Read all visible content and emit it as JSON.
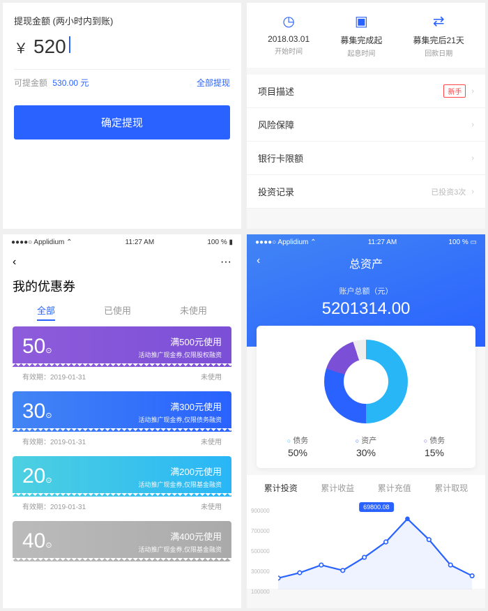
{
  "s1": {
    "label": "提现金额 (两小时内到账)",
    "amount": "520",
    "avail_label": "可提金额",
    "avail_val": "530.00 元",
    "all_link": "全部提现",
    "btn": "确定提现"
  },
  "s2": {
    "cols": [
      {
        "v1": "2018.03.01",
        "v2": "开始时间"
      },
      {
        "v1": "募集完成起",
        "v2": "起息时间"
      },
      {
        "v1": "募集完后21天",
        "v2": "回款日期"
      }
    ],
    "rows": [
      {
        "label": "项目描述",
        "badge": "新手"
      },
      {
        "label": "风险保障"
      },
      {
        "label": "银行卡限额"
      },
      {
        "label": "投资记录",
        "note": "已投资3次"
      }
    ]
  },
  "s3": {
    "status": {
      "carrier": "●●●●○ Applidium ⌃",
      "time": "11:27 AM",
      "batt": "100 % ▮"
    },
    "title": "我的优惠券",
    "tabs": [
      "全部",
      "已使用",
      "未使用"
    ],
    "coupons": [
      {
        "amt": "50",
        "cond": "满500元使用",
        "desc": "活动推广现金券,仅限股权融资",
        "exp": "有效期：2019-01-31",
        "status": "未使用",
        "cls": "c-purple"
      },
      {
        "amt": "30",
        "cond": "满300元使用",
        "desc": "活动推广现金券,仅限债务融资",
        "exp": "有效期：2019-01-31",
        "status": "未使用",
        "cls": "c-blue1"
      },
      {
        "amt": "20",
        "cond": "满200元使用",
        "desc": "活动推广现金券,仅限基金融资",
        "exp": "有效期：2019-01-31",
        "status": "未使用",
        "cls": "c-blue2"
      },
      {
        "amt": "40",
        "cond": "满400元使用",
        "desc": "活动推广现金券,仅限基金融资",
        "exp": "",
        "status": "",
        "cls": "c-gray"
      }
    ]
  },
  "s4": {
    "status": {
      "carrier": "●●●●○ Applidium ⌃",
      "time": "11:27 AM",
      "batt": "100 % ▭"
    },
    "title": "总资产",
    "sublabel": "账户总额（元）",
    "total": "5201314.00",
    "legend": [
      {
        "name": "债务",
        "val": "50%",
        "color": "#29b6f6"
      },
      {
        "name": "资产",
        "val": "30%",
        "color": "#2962ff"
      },
      {
        "name": "债务",
        "val": "15%",
        "color": "#7b4fd6"
      }
    ],
    "tabs": [
      "累计投资",
      "累计收益",
      "累计充值",
      "累计取现"
    ],
    "ylabels": [
      "900000",
      "700000",
      "500000",
      "300000",
      "100000"
    ],
    "peak": "69800.08"
  },
  "chart_data": {
    "type": "line",
    "x": [
      1,
      2,
      3,
      4,
      5,
      6,
      7,
      8,
      9,
      10
    ],
    "values": [
      150000,
      200000,
      280000,
      220000,
      350000,
      500000,
      750000,
      550000,
      300000,
      180000
    ],
    "peak_value": 69800.08,
    "ylim": [
      100000,
      900000
    ]
  }
}
